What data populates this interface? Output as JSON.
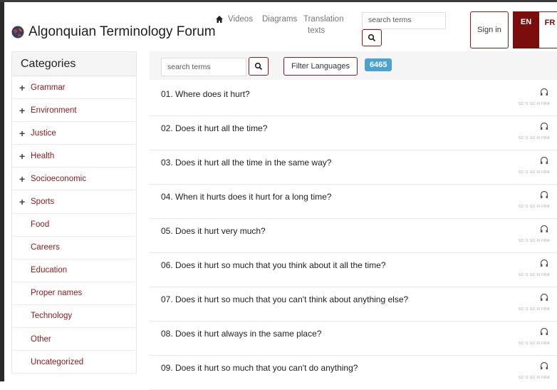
{
  "header": {
    "site_title": "Algonquian Terminology Forum",
    "nav": {
      "videos": "Videos",
      "diagrams": "Diagrams",
      "translation_line1": "Translation",
      "translation_line2": "texts"
    },
    "search_placeholder": "search terms",
    "sign_in": "Sign in",
    "lang_en": "EN",
    "lang_fr": "FR"
  },
  "sidebar": {
    "title": "Categories",
    "items": [
      {
        "label": "Grammar",
        "expandable": true
      },
      {
        "label": "Environment",
        "expandable": true
      },
      {
        "label": "Justice",
        "expandable": true
      },
      {
        "label": "Health",
        "expandable": true
      },
      {
        "label": "Socioeconomic",
        "expandable": true
      },
      {
        "label": "Sports",
        "expandable": true
      },
      {
        "label": "Food",
        "expandable": false
      },
      {
        "label": "Careers",
        "expandable": false
      },
      {
        "label": "Education",
        "expandable": false
      },
      {
        "label": "Proper names",
        "expandable": false
      },
      {
        "label": "Technology",
        "expandable": false
      },
      {
        "label": "Other",
        "expandable": false
      },
      {
        "label": "Uncategorized",
        "expandable": false
      }
    ]
  },
  "toolbar": {
    "search_placeholder": "search terms",
    "filter_label": "Filter Languages",
    "count": "6465"
  },
  "terms": [
    {
      "text": "01. Where does it hurt?",
      "langs": "SC-S  SC-N  FRA"
    },
    {
      "text": "02. Does it hurt all the time?",
      "langs": "SC-S  SC-N  FRA"
    },
    {
      "text": "03. Does it hurt all the time in the same way?",
      "langs": "SC-S  SC-N  FRA"
    },
    {
      "text": "04. When it hurts does it hurt for a long time?",
      "langs": "SC-S  SC-N  FRA"
    },
    {
      "text": "05. Does it hurt very much?",
      "langs": "SC-S  SC-N  FRA"
    },
    {
      "text": "06. Does it hurt so much that you think about it all the time?",
      "langs": "SC-S  SC-N  FRA"
    },
    {
      "text": "07. Does it hurt so much that you can't think about anything else?",
      "langs": "SC-S  SC-N  FRA"
    },
    {
      "text": "08. Does it hurt always in the same place?",
      "langs": "SC-S  SC-N  FRA"
    },
    {
      "text": "09. Does it hurt so much that you can't do anything?",
      "langs": "SC-S  SC-N  FRA"
    }
  ],
  "colors": {
    "accent": "#7a0c0c",
    "link": "#8b1a1a",
    "badge": "#4aa3cf"
  },
  "icons": {
    "logo": "globe-logo-icon",
    "home": "home-icon",
    "search": "search-icon",
    "plus": "plus-icon",
    "audio": "headphones-icon"
  }
}
